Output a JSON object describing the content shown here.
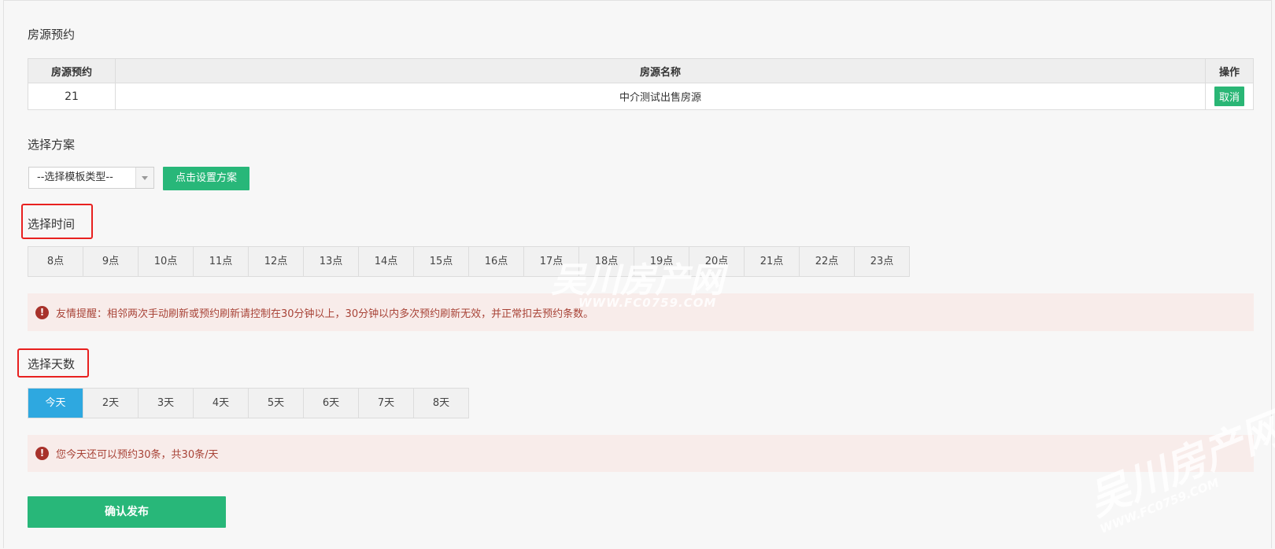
{
  "reservation_section": {
    "title": "房源预约",
    "columns": [
      "房源预约",
      "房源名称",
      "操作"
    ],
    "rows": [
      {
        "id": "21",
        "name": "中介测试出售房源",
        "action": "取消"
      }
    ]
  },
  "plan_section": {
    "title": "选择方案",
    "select_value": "--选择模板类型--",
    "set_plan_button": "点击设置方案"
  },
  "time_section": {
    "title": "选择时间",
    "hours": [
      "8点",
      "9点",
      "10点",
      "11点",
      "12点",
      "13点",
      "14点",
      "15点",
      "16点",
      "17点",
      "18点",
      "19点",
      "20点",
      "21点",
      "22点",
      "23点"
    ],
    "alert": "友情提醒：相邻两次手动刷新或预约刷新请控制在30分钟以上，30分钟以内多次预约刷新无效，并正常扣去预约条数。"
  },
  "days_section": {
    "title": "选择天数",
    "days": [
      "今天",
      "2天",
      "3天",
      "4天",
      "5天",
      "6天",
      "7天",
      "8天"
    ],
    "active_index": 0,
    "alert": "您今天还可以预约30条，共30条/天"
  },
  "confirm_button": "确认发布",
  "watermark": {
    "brand": "吴川房产网",
    "url": "WWW.FC0759.COM"
  },
  "colors": {
    "green": "#28b779",
    "blue_active": "#2ea8e0",
    "alert_bg": "#f8ecea",
    "alert_text": "#a84337",
    "highlight": "#e8201f"
  },
  "icons": {
    "alert": "exclamation-circle-icon",
    "select": "chevron-down-icon"
  }
}
